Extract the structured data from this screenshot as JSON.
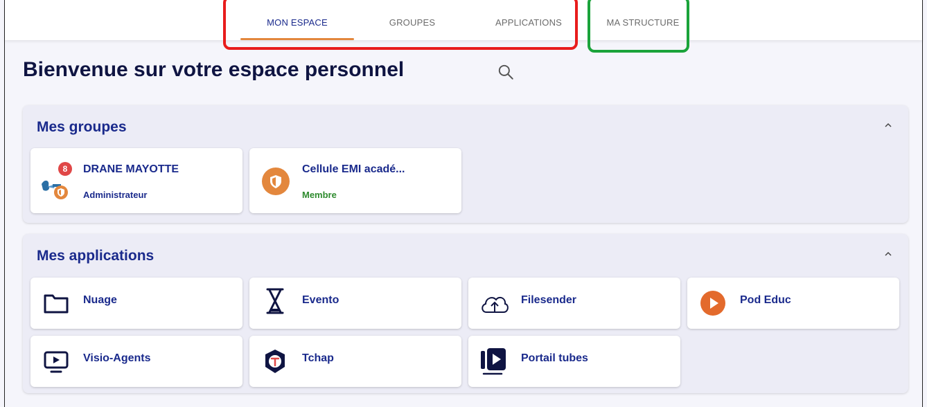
{
  "tabs": [
    {
      "label": "MON ESPACE",
      "active": true
    },
    {
      "label": "GROUPES",
      "active": false
    },
    {
      "label": "APPLICATIONS",
      "active": false
    },
    {
      "label": "MA STRUCTURE",
      "active": false
    }
  ],
  "page": {
    "title": "Bienvenue sur votre espace personnel"
  },
  "groups_section": {
    "title": "Mes groupes",
    "cards": [
      {
        "name": "DRANE MAYOTTE",
        "role": "Administrateur",
        "badge": "8"
      },
      {
        "name": "Cellule EMI acadé...",
        "role": "Membre"
      }
    ]
  },
  "apps_section": {
    "title": "Mes applications",
    "apps": [
      {
        "name": "Nuage",
        "icon": "folder-icon"
      },
      {
        "name": "Evento",
        "icon": "hourglass-icon"
      },
      {
        "name": "Filesender",
        "icon": "cloud-upload-icon"
      },
      {
        "name": "Pod Educ",
        "icon": "play-circle-icon"
      },
      {
        "name": "Visio-Agents",
        "icon": "screen-play-icon"
      },
      {
        "name": "Tchap",
        "icon": "tchap-icon"
      },
      {
        "name": "Portail tubes",
        "icon": "tubes-icon"
      }
    ]
  },
  "colors": {
    "accent_orange": "#e3873d",
    "brand_blue": "#1a2a8c",
    "highlight_red": "#e81c1c",
    "highlight_green": "#1aa33a",
    "member_green": "#2e8b2e"
  }
}
